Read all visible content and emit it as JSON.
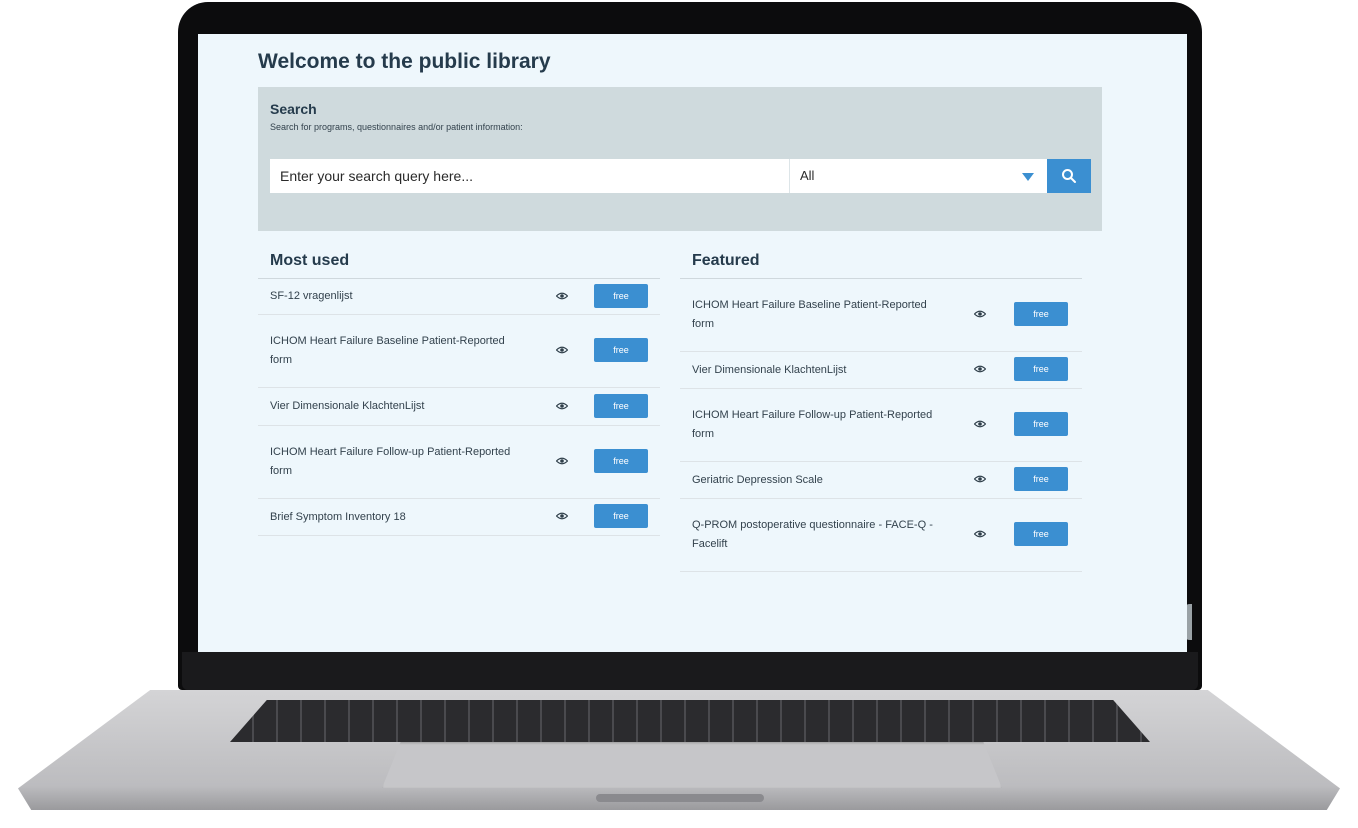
{
  "page": {
    "title": "Welcome to the public library"
  },
  "search": {
    "heading": "Search",
    "subtitle": "Search for programs, questionnaires and/or patient information:",
    "placeholder": "Enter your search query here...",
    "scope_selected": "All",
    "button_icon": "search-icon"
  },
  "most_used": {
    "heading": "Most used",
    "items": [
      {
        "name": "SF-12 vragenlijst",
        "badge": "free",
        "icon": "eye-icon"
      },
      {
        "name": "ICHOM Heart Failure Baseline Patient-Reported form",
        "badge": "free",
        "icon": "eye-icon"
      },
      {
        "name": "Vier Dimensionale KlachtenLijst",
        "badge": "free",
        "icon": "eye-icon"
      },
      {
        "name": "ICHOM Heart Failure Follow-up Patient-Reported form",
        "badge": "free",
        "icon": "eye-icon"
      },
      {
        "name": "Brief Symptom Inventory 18",
        "badge": "free",
        "icon": "eye-icon"
      }
    ]
  },
  "featured": {
    "heading": "Featured",
    "items": [
      {
        "name": "ICHOM Heart Failure Baseline Patient-Reported form",
        "badge": "free",
        "icon": "eye-icon"
      },
      {
        "name": "Vier Dimensionale KlachtenLijst",
        "badge": "free",
        "icon": "eye-icon"
      },
      {
        "name": "ICHOM Heart Failure Follow-up Patient-Reported form",
        "badge": "free",
        "icon": "eye-icon"
      },
      {
        "name": "Geriatric Depression Scale",
        "badge": "free",
        "icon": "eye-icon"
      },
      {
        "name": "Q-PROM postoperative questionnaire - FACE-Q - Facelift",
        "badge": "free",
        "icon": "eye-icon"
      }
    ]
  },
  "colors": {
    "accent": "#3b8fd1",
    "heading": "#253b4c",
    "screen_background": "#eef7fc",
    "search_panel": "#cfdadd"
  }
}
